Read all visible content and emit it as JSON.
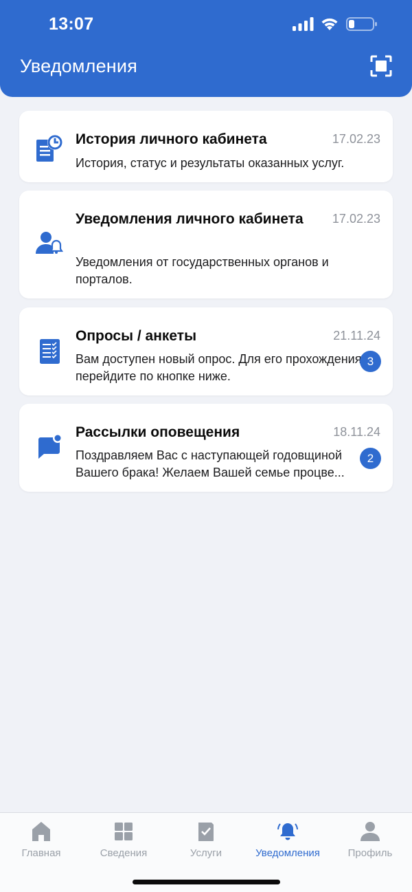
{
  "status_bar": {
    "time": "13:07"
  },
  "header": {
    "title": "Уведомления",
    "scan_icon": "scan-icon"
  },
  "notifications": [
    {
      "icon": "history-document-clock-icon",
      "title": "История личного кабинета",
      "date": "17.02.23",
      "description": "История, статус и результаты оказанных услуг.",
      "badge": null
    },
    {
      "icon": "person-notification-icon",
      "title": "Уведомления личного кабинета",
      "date": "17.02.23",
      "description": "Уведомления от государственных органов и порталов.",
      "badge": null
    },
    {
      "icon": "survey-checklist-icon",
      "title": "Опросы / анкеты",
      "date": "21.11.24",
      "description": "Вам доступен новый опрос. Для его прохождения перейдите по кнопке ниже.",
      "badge": "3"
    },
    {
      "icon": "chat-message-dot-icon",
      "title": "Рассылки оповещения",
      "date": "18.11.24",
      "description": "Поздравляем Вас с наступающей годовщиной Вашего брака! Желаем Вашей семье процве...",
      "badge": "2"
    }
  ],
  "tabbar": {
    "tabs": [
      {
        "label": "Главная",
        "icon": "home-icon",
        "active": false
      },
      {
        "label": "Сведения",
        "icon": "grid-icon",
        "active": false
      },
      {
        "label": "Услуги",
        "icon": "document-check-icon",
        "active": false
      },
      {
        "label": "Уведомления",
        "icon": "bell-icon",
        "active": true
      },
      {
        "label": "Профиль",
        "icon": "user-icon",
        "active": false
      }
    ]
  },
  "colors": {
    "accent": "#2f6bcf",
    "background": "#f0f2f7",
    "inactive_tab": "#9aa0a8",
    "date_text": "#8e929a"
  }
}
